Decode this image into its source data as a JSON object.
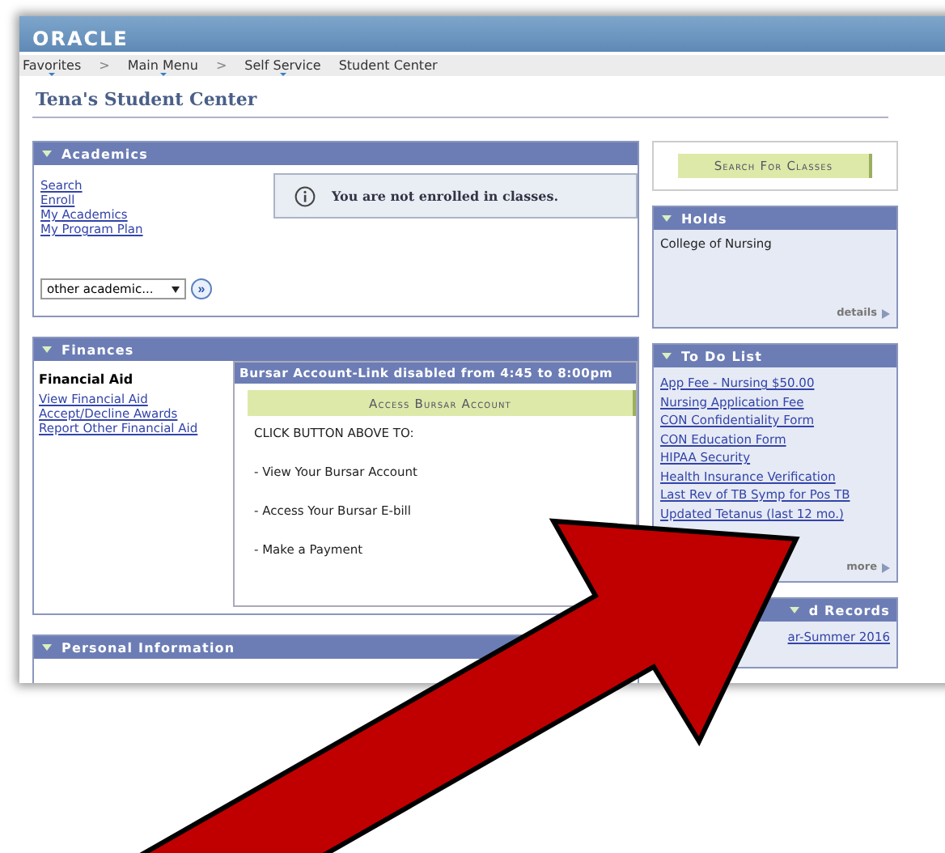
{
  "header": {
    "logo": "ORACLE"
  },
  "nav": [
    {
      "label": "Favorites",
      "menu": true
    },
    {
      "label": "Main Menu",
      "menu": true,
      "separator": ">"
    },
    {
      "label": "Self Service",
      "menu": true,
      "separator": ">"
    },
    {
      "label": "Student Center",
      "menu": false
    }
  ],
  "page_title": "Tena's Student Center",
  "academics": {
    "title": "Academics",
    "links": [
      "Search",
      "Enroll",
      "My Academics",
      "My Program Plan"
    ],
    "notice": "You are not enrolled in classes.",
    "dropdown": {
      "value": "other academic..."
    },
    "go_button": "»"
  },
  "finances": {
    "title": "Finances",
    "aid_heading": "Financial Aid",
    "links": [
      "View Financial Aid",
      "Accept/Decline Awards",
      "Report Other Financial Aid"
    ],
    "bursar": {
      "title": "Bursar Account-Link disabled from 4:45 to 8:00pm",
      "button": "Access Bursar Account",
      "lines": [
        "CLICK BUTTON ABOVE TO:",
        "- View Your Bursar Account",
        "- Access Your Bursar E-bill",
        "- Make a Payment"
      ]
    }
  },
  "personal": {
    "title": "Personal Information"
  },
  "search_button": "Search For Classes",
  "holds": {
    "title": "Holds",
    "items": [
      "College of Nursing"
    ],
    "link": "details"
  },
  "todo": {
    "title": "To Do List",
    "items": [
      "App Fee - Nursing $50.00",
      "Nursing Application Fee",
      "CON Confidentiality Form",
      "CON Education Form",
      "HIPAA Security",
      "Health Insurance Verification",
      "Last Rev of TB Symp for Pos TB",
      "Updated Tetanus (last 12 mo.)"
    ],
    "link": "more"
  },
  "records": {
    "title": "d Records",
    "items": [
      "ar-Summer 2016"
    ]
  }
}
